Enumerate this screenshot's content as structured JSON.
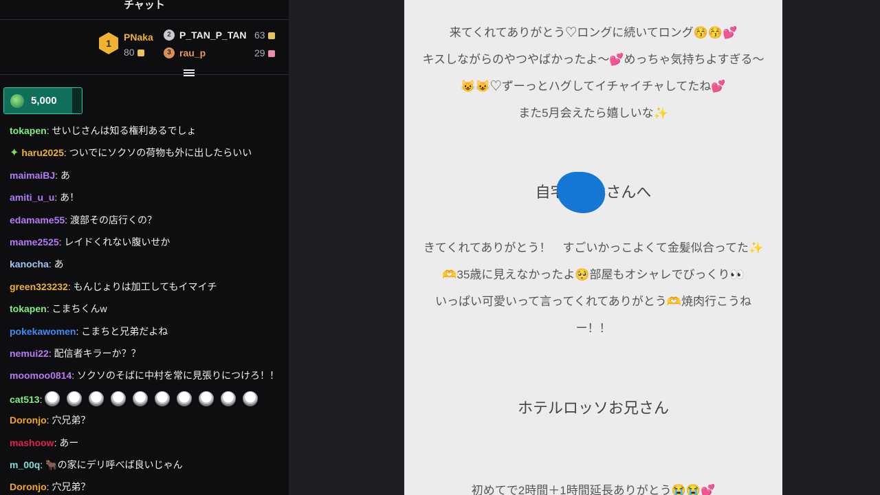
{
  "chat": {
    "title": "チャット",
    "leaderboard": {
      "first": {
        "rank": "1",
        "name": "PNaka",
        "points": "80"
      },
      "second": {
        "rank": "2",
        "name": "P_TAN_P_TAN",
        "points": "63"
      },
      "third": {
        "rank": "3",
        "name": "rau_p",
        "points": "29"
      }
    },
    "goal": {
      "amount": "5,000",
      "progress": 0.88
    },
    "messages": [
      {
        "user": "tokapen",
        "color": "#7ef07e",
        "text": "せいじさんは知る権利あるでしょ"
      },
      {
        "user": "haru2025",
        "color": "#f0b233",
        "text": "ついでにソクソの荷物も外に出したらいい",
        "badge": "star"
      },
      {
        "user": "maimaiBJ",
        "color": "#b57bf5",
        "text": "あ"
      },
      {
        "user": "amiti_u_u",
        "color": "#b57bf5",
        "text": "あ！"
      },
      {
        "user": "edamame55",
        "color": "#b57bf5",
        "text": "渡部その店行くの？"
      },
      {
        "user": "mame2525",
        "color": "#b57bf5",
        "text": "レイドくれない腹いせか"
      },
      {
        "user": "kanocha",
        "color": "#9fc6f5",
        "text": "あ"
      },
      {
        "user": "green323232",
        "color": "#f0b233",
        "text": "もんじょりは加工してもイマイチ"
      },
      {
        "user": "tokapen",
        "color": "#7ef07e",
        "text": "こまちくんw"
      },
      {
        "user": "pokekawomen",
        "color": "#3d8bf5",
        "text": "こまちと兄弟だよね"
      },
      {
        "user": "nemui22",
        "color": "#b57bf5",
        "text": "配信者キラーか？？"
      },
      {
        "user": "moomoo0814",
        "color": "#b57bf5",
        "text": "ソクソのそばに中村を常に見張りにつけろ！！"
      },
      {
        "user": "cat513",
        "color": "#7ef07e",
        "text": "",
        "emotes": 10
      },
      {
        "user": "Doronjo",
        "color": "#f5a623",
        "text": "穴兄弟？"
      },
      {
        "user": "mashoow",
        "color": "#e0204f",
        "text": "あー"
      },
      {
        "user": "m_00q",
        "color": "#7ce3dc",
        "text": "🐂の家にデリ呼べば良いじゃん"
      },
      {
        "user": "Doronjo",
        "color": "#f5a623",
        "text": "穴兄弟？"
      }
    ]
  },
  "letter": {
    "lines": [
      "来てくれてありがとう♡ロングに続いてロング😚😚💕",
      "キスしながらのやつやばかったよ〜💕めっちゃ気持ちよすぎる〜",
      "😺😺♡ずーっとハグしてイチャイチャしてたね💕",
      "また5月会えたら嬉しいな✨"
    ],
    "heading1": "自宅　　Sさんへ",
    "lines2": [
      "きてくれてありがとう！　すごいかっこよくて金髪似合ってた✨",
      "🫶35歳に見えなかったよ🥺部屋もオシャレでびっくり👀",
      "いっぱい可愛いって言ってくれてありがとう🫶焼肉行こうね",
      "ー！！"
    ],
    "heading2": "ホテルロッソお兄さん",
    "lines3": [
      "初めてで2時間＋1時間延長ありがとう😭😭💕"
    ]
  }
}
